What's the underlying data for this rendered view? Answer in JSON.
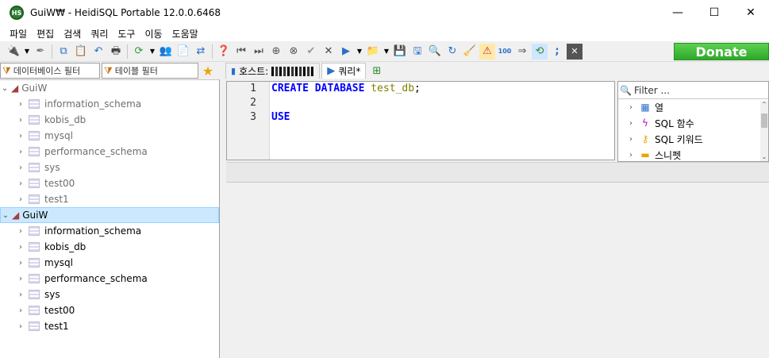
{
  "window": {
    "app_icon_text": "HS",
    "title": "GuiW₩ - HeidiSQL Portable 12.0.0.6468",
    "minimize": "—",
    "maximize": "☐",
    "close": "✕"
  },
  "menu": [
    "파일",
    "편집",
    "검색",
    "쿼리",
    "도구",
    "이동",
    "도움말"
  ],
  "donate_label": "Donate",
  "filters": {
    "db_filter_placeholder": "데이터베이스 필터",
    "table_filter_placeholder": "테이블 필터"
  },
  "tree": {
    "sessions": [
      {
        "name": "GuiW",
        "dimmed": true,
        "databases": [
          "information_schema",
          "kobis_db",
          "mysql",
          "performance_schema",
          "sys",
          "test00",
          "test1"
        ]
      },
      {
        "name": "GuiW",
        "dimmed": false,
        "databases": [
          "information_schema",
          "kobis_db",
          "mysql",
          "performance_schema",
          "sys",
          "test00",
          "test1"
        ]
      }
    ]
  },
  "tabs": {
    "host_label": "호스트:",
    "query_label": "쿼리*"
  },
  "editor": {
    "line_numbers": [
      "1",
      "2",
      "3"
    ],
    "line1_kw": "CREATE DATABASE",
    "line1_id": "test_db",
    "line1_end": ";",
    "line3_kw": "USE"
  },
  "helper": {
    "filter_placeholder": "Filter ...",
    "items": [
      "열",
      "SQL 함수",
      "SQL 키워드",
      "스니펫"
    ]
  },
  "colors": {
    "donate_green": "#2ea82a",
    "selection": "#cce8ff",
    "keyword": "#0000ff",
    "identifier": "#808000"
  }
}
